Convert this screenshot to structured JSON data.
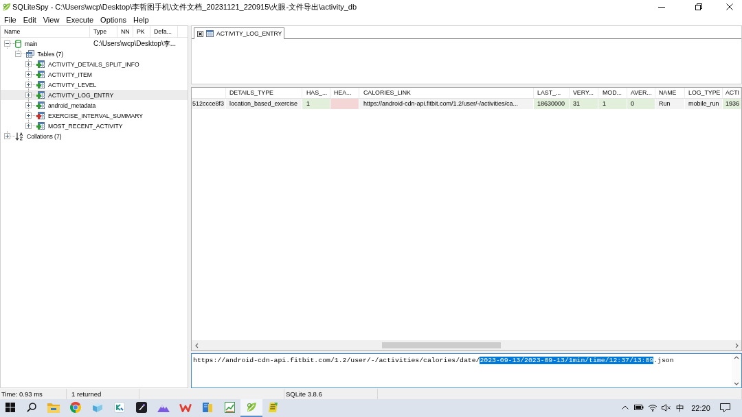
{
  "window": {
    "title": "SQLiteSpy - C:\\Users\\wcp\\Desktop\\李哲图手机\\文件文档_20231121_220915\\火眼-文件导出\\activity_db"
  },
  "menu": [
    "File",
    "Edit",
    "View",
    "Execute",
    "Options",
    "Help"
  ],
  "schema": {
    "columns": [
      "Name",
      "Type",
      "NN",
      "PK",
      "Defa..."
    ],
    "tree": [
      {
        "label": "main",
        "detail": "C:\\Users\\wcp\\Desktop\\李...",
        "kind": "database",
        "expanded": true,
        "selected": false,
        "children": [
          {
            "label": "Tables (7)",
            "kind": "tables",
            "expanded": true,
            "selected": false,
            "children": [
              {
                "label": "ACTIVITY_DETAILS_SPLIT_INFO",
                "kind": "table",
                "color": "#2f9a2f",
                "expanded": false,
                "selected": false
              },
              {
                "label": "ACTIVITY_ITEM",
                "kind": "table",
                "color": "#2f9a2f",
                "expanded": false,
                "selected": false
              },
              {
                "label": "ACTIVITY_LEVEL",
                "kind": "table",
                "color": "#2f9a2f",
                "expanded": false,
                "selected": false
              },
              {
                "label": "ACTIVITY_LOG_ENTRY",
                "kind": "table",
                "color": "#2f9a2f",
                "expanded": false,
                "selected": true
              },
              {
                "label": "android_metadata",
                "kind": "table",
                "color": "#2f9a2f",
                "expanded": false,
                "selected": false
              },
              {
                "label": "EXERCISE_INTERVAL_SUMMARY",
                "kind": "table",
                "color": "#c8302a",
                "expanded": false,
                "selected": false
              },
              {
                "label": "MOST_RECENT_ACTIVITY",
                "kind": "table",
                "color": "#2f9a2f",
                "expanded": false,
                "selected": false
              }
            ]
          }
        ]
      },
      {
        "label": "Collations (7)",
        "kind": "collations",
        "expanded": false,
        "selected": false
      }
    ]
  },
  "editor": {
    "tabs": [
      {
        "label": "ACTIVITY_LOG_ENTRY",
        "selected": true
      }
    ]
  },
  "results": {
    "columns": [
      null,
      "DETAILS_TYPE",
      "HAS_...",
      "HEA...",
      "CALORIES_LINK",
      "LAST_...",
      "VERY...",
      "MOD...",
      "AVER...",
      "NAME",
      "LOG_TYPE",
      "ACTI"
    ],
    "rows": [
      {
        "cells": [
          {
            "kind": "text",
            "text": "512ccce8f3"
          },
          {
            "kind": "text",
            "text": "location_based_exercise"
          },
          {
            "kind": "integer",
            "text": "1"
          },
          {
            "kind": "null"
          },
          {
            "kind": "text",
            "text": "https://android-cdn-api.fitbit.com/1.2/user/-/activities/ca..."
          },
          {
            "kind": "integer",
            "text": "18630000"
          },
          {
            "kind": "integer",
            "text": "31"
          },
          {
            "kind": "integer",
            "text": "1"
          },
          {
            "kind": "integer",
            "text": "0"
          },
          {
            "kind": "text",
            "text": "Run"
          },
          {
            "kind": "text",
            "text": "mobile_run"
          },
          {
            "kind": "integer",
            "text": "1936"
          }
        ]
      }
    ]
  },
  "value_panel": {
    "parts": [
      {
        "text": "https://android-cdn-api.fitbit.com/1.2/user/-/activities/calories/date/",
        "selected": false
      },
      {
        "text": "2023-09-13/2023-09-13/1min/time/12:37/13:09",
        "selected": true
      },
      {
        "text": ".json",
        "selected": false
      }
    ]
  },
  "status_bar": {
    "time": "Time: 0.93 ms",
    "rows": "1 returned",
    "version": "SQLite 3.8.6"
  },
  "taskbar": {
    "apps": [
      {
        "selected": false
      },
      {
        "selected": false
      },
      {
        "selected": false
      },
      {
        "selected": false
      },
      {
        "selected": false
      },
      {
        "selected": false
      },
      {
        "selected": false
      },
      {
        "selected": false
      },
      {
        "selected": false
      },
      {
        "selected": true
      },
      {
        "selected": false
      }
    ],
    "tray": {
      "input_method": "中",
      "clock": "22:20"
    }
  }
}
